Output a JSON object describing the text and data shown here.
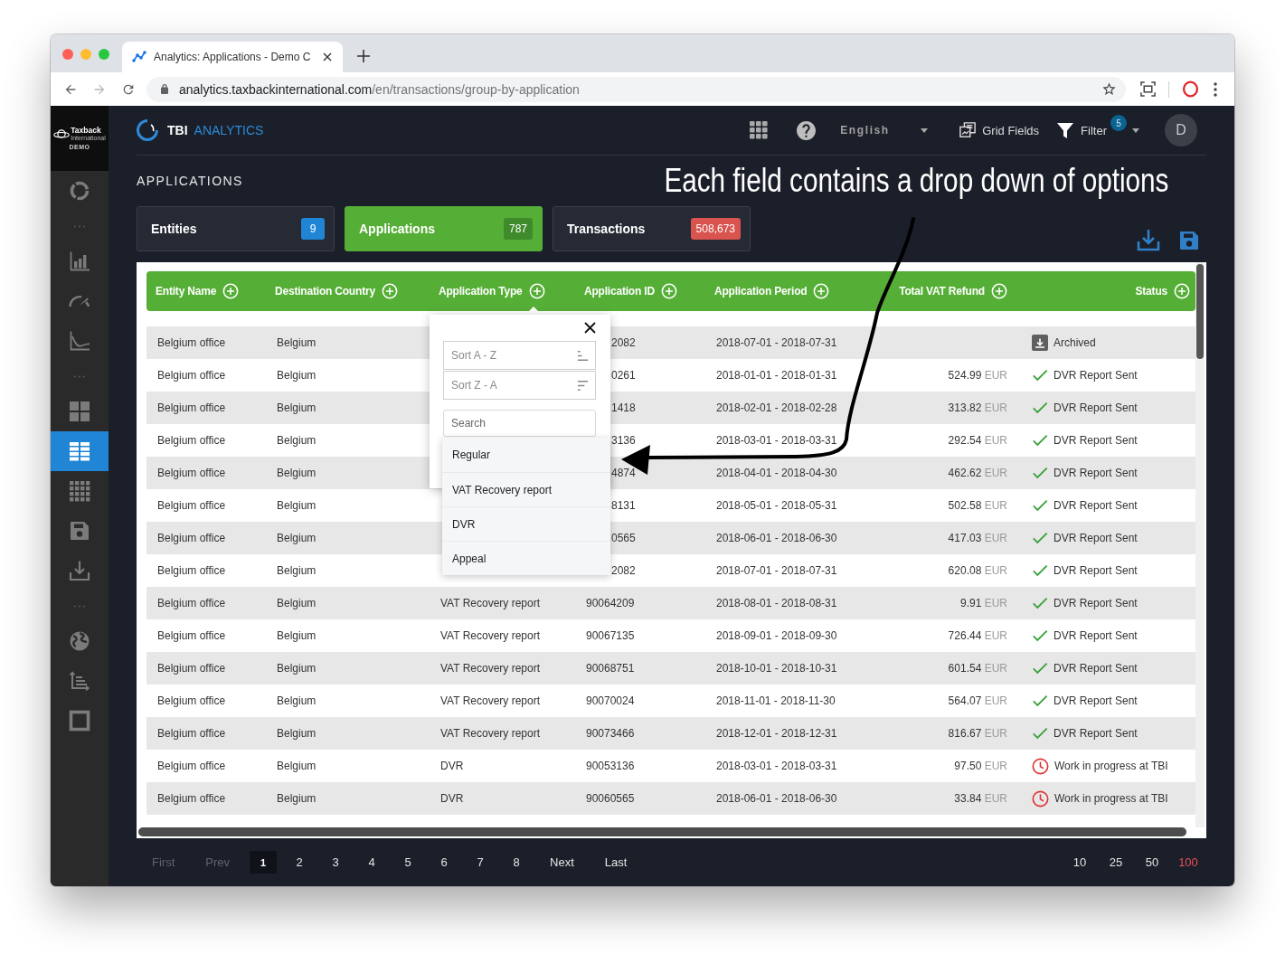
{
  "browser": {
    "tab": {
      "title": "Analytics: Applications - Demo C"
    },
    "url": {
      "host": "analytics.taxbackinternational.com",
      "path": "/en/transactions/group-by-application"
    }
  },
  "sidebar": {
    "logo": {
      "name": "Taxback",
      "subtitle": "International",
      "edition": "DEMO"
    },
    "items": [
      {
        "kind": "nav",
        "selected": false
      },
      {
        "kind": "divider"
      },
      {
        "kind": "nav",
        "selected": false
      },
      {
        "kind": "nav",
        "selected": false
      },
      {
        "kind": "nav",
        "selected": false
      },
      {
        "kind": "divider"
      },
      {
        "kind": "nav",
        "selected": false
      },
      {
        "kind": "nav",
        "selected": true
      },
      {
        "kind": "nav",
        "selected": false
      },
      {
        "kind": "nav",
        "selected": false
      },
      {
        "kind": "nav",
        "selected": false
      },
      {
        "kind": "divider"
      },
      {
        "kind": "nav",
        "selected": false
      },
      {
        "kind": "nav",
        "selected": false
      },
      {
        "kind": "nav",
        "selected": false
      }
    ]
  },
  "header": {
    "brand": {
      "name": "TBI",
      "product": "ANALYTICS"
    },
    "language": "English",
    "grid_fields": "Grid Fields",
    "filter": {
      "label": "Filter",
      "count": "5"
    },
    "avatar": "D"
  },
  "page": {
    "title": "APPLICATIONS"
  },
  "annotation": {
    "text": "Each field contains a drop down of options"
  },
  "cards": [
    {
      "label": "Entities",
      "count": "9",
      "color": "#2185d5",
      "selected": false
    },
    {
      "label": "Applications",
      "count": "787",
      "color": "#3f8a2a",
      "selected": true
    },
    {
      "label": "Transactions",
      "count": "508,673",
      "color": "#d9534f",
      "selected": false
    }
  ],
  "table": {
    "columns": [
      {
        "label": "Entity Name",
        "kind": "text"
      },
      {
        "label": "Destination Country",
        "kind": "text"
      },
      {
        "label": "Application Type",
        "kind": "text"
      },
      {
        "label": "Application ID",
        "kind": "text"
      },
      {
        "label": "Application Period",
        "kind": "text"
      },
      {
        "label": "Total VAT Refund",
        "kind": "amount"
      },
      {
        "label": "Status",
        "kind": "status"
      }
    ],
    "rows": [
      {
        "entity_name": "Belgium office",
        "destination_country": "Belgium",
        "application_id": "2082",
        "application_period": "2018-07-01 - 2018-07-31",
        "status": {
          "kind": "archived",
          "label": "Archived"
        }
      },
      {
        "entity_name": "Belgium office",
        "destination_country": "Belgium",
        "application_id": "0261",
        "application_period": "2018-01-01 - 2018-01-31",
        "total_vat_refund": {
          "amount": "524.99",
          "currency": "EUR"
        },
        "status": {
          "kind": "sent",
          "label": "DVR Report Sent"
        }
      },
      {
        "entity_name": "Belgium office",
        "destination_country": "Belgium",
        "application_id": "1418",
        "application_period": "2018-02-01 - 2018-02-28",
        "total_vat_refund": {
          "amount": "313.82",
          "currency": "EUR"
        },
        "status": {
          "kind": "sent",
          "label": "DVR Report Sent"
        }
      },
      {
        "entity_name": "Belgium office",
        "destination_country": "Belgium",
        "application_id": "3136",
        "application_period": "2018-03-01 - 2018-03-31",
        "total_vat_refund": {
          "amount": "292.54",
          "currency": "EUR"
        },
        "status": {
          "kind": "sent",
          "label": "DVR Report Sent"
        }
      },
      {
        "entity_name": "Belgium office",
        "destination_country": "Belgium",
        "application_id": "4874",
        "application_period": "2018-04-01 - 2018-04-30",
        "total_vat_refund": {
          "amount": "462.62",
          "currency": "EUR"
        },
        "status": {
          "kind": "sent",
          "label": "DVR Report Sent"
        }
      },
      {
        "entity_name": "Belgium office",
        "destination_country": "Belgium",
        "application_id": "8131",
        "application_period": "2018-05-01 - 2018-05-31",
        "total_vat_refund": {
          "amount": "502.58",
          "currency": "EUR"
        },
        "status": {
          "kind": "sent",
          "label": "DVR Report Sent"
        }
      },
      {
        "entity_name": "Belgium office",
        "destination_country": "Belgium",
        "application_id": "0565",
        "application_period": "2018-06-01 - 2018-06-30",
        "total_vat_refund": {
          "amount": "417.03",
          "currency": "EUR"
        },
        "status": {
          "kind": "sent",
          "label": "DVR Report Sent"
        }
      },
      {
        "entity_name": "Belgium office",
        "destination_country": "Belgium",
        "application_id": "2082",
        "application_period": "2018-07-01 - 2018-07-31",
        "total_vat_refund": {
          "amount": "620.08",
          "currency": "EUR"
        },
        "status": {
          "kind": "sent",
          "label": "DVR Report Sent"
        }
      },
      {
        "entity_name": "Belgium office",
        "destination_country": "Belgium",
        "application_type": "VAT Recovery report",
        "application_id": "90064209",
        "application_period": "2018-08-01 - 2018-08-31",
        "total_vat_refund": {
          "amount": "9.91",
          "currency": "EUR"
        },
        "status": {
          "kind": "sent",
          "label": "DVR Report Sent"
        }
      },
      {
        "entity_name": "Belgium office",
        "destination_country": "Belgium",
        "application_type": "VAT Recovery report",
        "application_id": "90067135",
        "application_period": "2018-09-01 - 2018-09-30",
        "total_vat_refund": {
          "amount": "726.44",
          "currency": "EUR"
        },
        "status": {
          "kind": "sent",
          "label": "DVR Report Sent"
        }
      },
      {
        "entity_name": "Belgium office",
        "destination_country": "Belgium",
        "application_type": "VAT Recovery report",
        "application_id": "90068751",
        "application_period": "2018-10-01 - 2018-10-31",
        "total_vat_refund": {
          "amount": "601.54",
          "currency": "EUR"
        },
        "status": {
          "kind": "sent",
          "label": "DVR Report Sent"
        }
      },
      {
        "entity_name": "Belgium office",
        "destination_country": "Belgium",
        "application_type": "VAT Recovery report",
        "application_id": "90070024",
        "application_period": "2018-11-01 - 2018-11-30",
        "total_vat_refund": {
          "amount": "564.07",
          "currency": "EUR"
        },
        "status": {
          "kind": "sent",
          "label": "DVR Report Sent"
        }
      },
      {
        "entity_name": "Belgium office",
        "destination_country": "Belgium",
        "application_type": "VAT Recovery report",
        "application_id": "90073466",
        "application_period": "2018-12-01 - 2018-12-31",
        "total_vat_refund": {
          "amount": "816.67",
          "currency": "EUR"
        },
        "status": {
          "kind": "sent",
          "label": "DVR Report Sent"
        }
      },
      {
        "entity_name": "Belgium office",
        "destination_country": "Belgium",
        "application_type": "DVR",
        "application_id": "90053136",
        "application_period": "2018-03-01 - 2018-03-31",
        "total_vat_refund": {
          "amount": "97.50",
          "currency": "EUR"
        },
        "status": {
          "kind": "in_progress",
          "label": "Work in progress at TBI"
        }
      },
      {
        "entity_name": "Belgium office",
        "destination_country": "Belgium",
        "application_type": "DVR",
        "application_id": "90060565",
        "application_period": "2018-06-01 - 2018-06-30",
        "total_vat_refund": {
          "amount": "33.84",
          "currency": "EUR"
        },
        "status": {
          "kind": "in_progress",
          "label": "Work in progress at TBI"
        }
      }
    ],
    "column_filter": {
      "sort_options": [
        {
          "label": "Sort A - Z",
          "kind": "ascending"
        },
        {
          "label": "Sort Z - A",
          "kind": "descending"
        }
      ],
      "search": {
        "placeholder": "Search"
      },
      "options": [
        "Regular",
        "VAT Recovery report",
        "DVR",
        "Appeal"
      ]
    }
  },
  "pagination": {
    "items": [
      {
        "label": "First",
        "kind": "nav",
        "disabled": true
      },
      {
        "label": "Prev",
        "kind": "nav",
        "disabled": true
      },
      {
        "label": "1",
        "kind": "page",
        "selected": true
      },
      {
        "label": "2",
        "kind": "page",
        "selected": false
      },
      {
        "label": "3",
        "kind": "page",
        "selected": false
      },
      {
        "label": "4",
        "kind": "page",
        "selected": false
      },
      {
        "label": "5",
        "kind": "page",
        "selected": false
      },
      {
        "label": "6",
        "kind": "page",
        "selected": false
      },
      {
        "label": "7",
        "kind": "page",
        "selected": false
      },
      {
        "label": "8",
        "kind": "page",
        "selected": false
      },
      {
        "label": "Next",
        "kind": "nav",
        "disabled": false
      },
      {
        "label": "Last",
        "kind": "nav",
        "disabled": false
      }
    ],
    "page_sizes": [
      {
        "label": "10",
        "selected": false
      },
      {
        "label": "25",
        "selected": false
      },
      {
        "label": "50",
        "selected": false
      },
      {
        "label": "100",
        "selected": true
      }
    ]
  }
}
